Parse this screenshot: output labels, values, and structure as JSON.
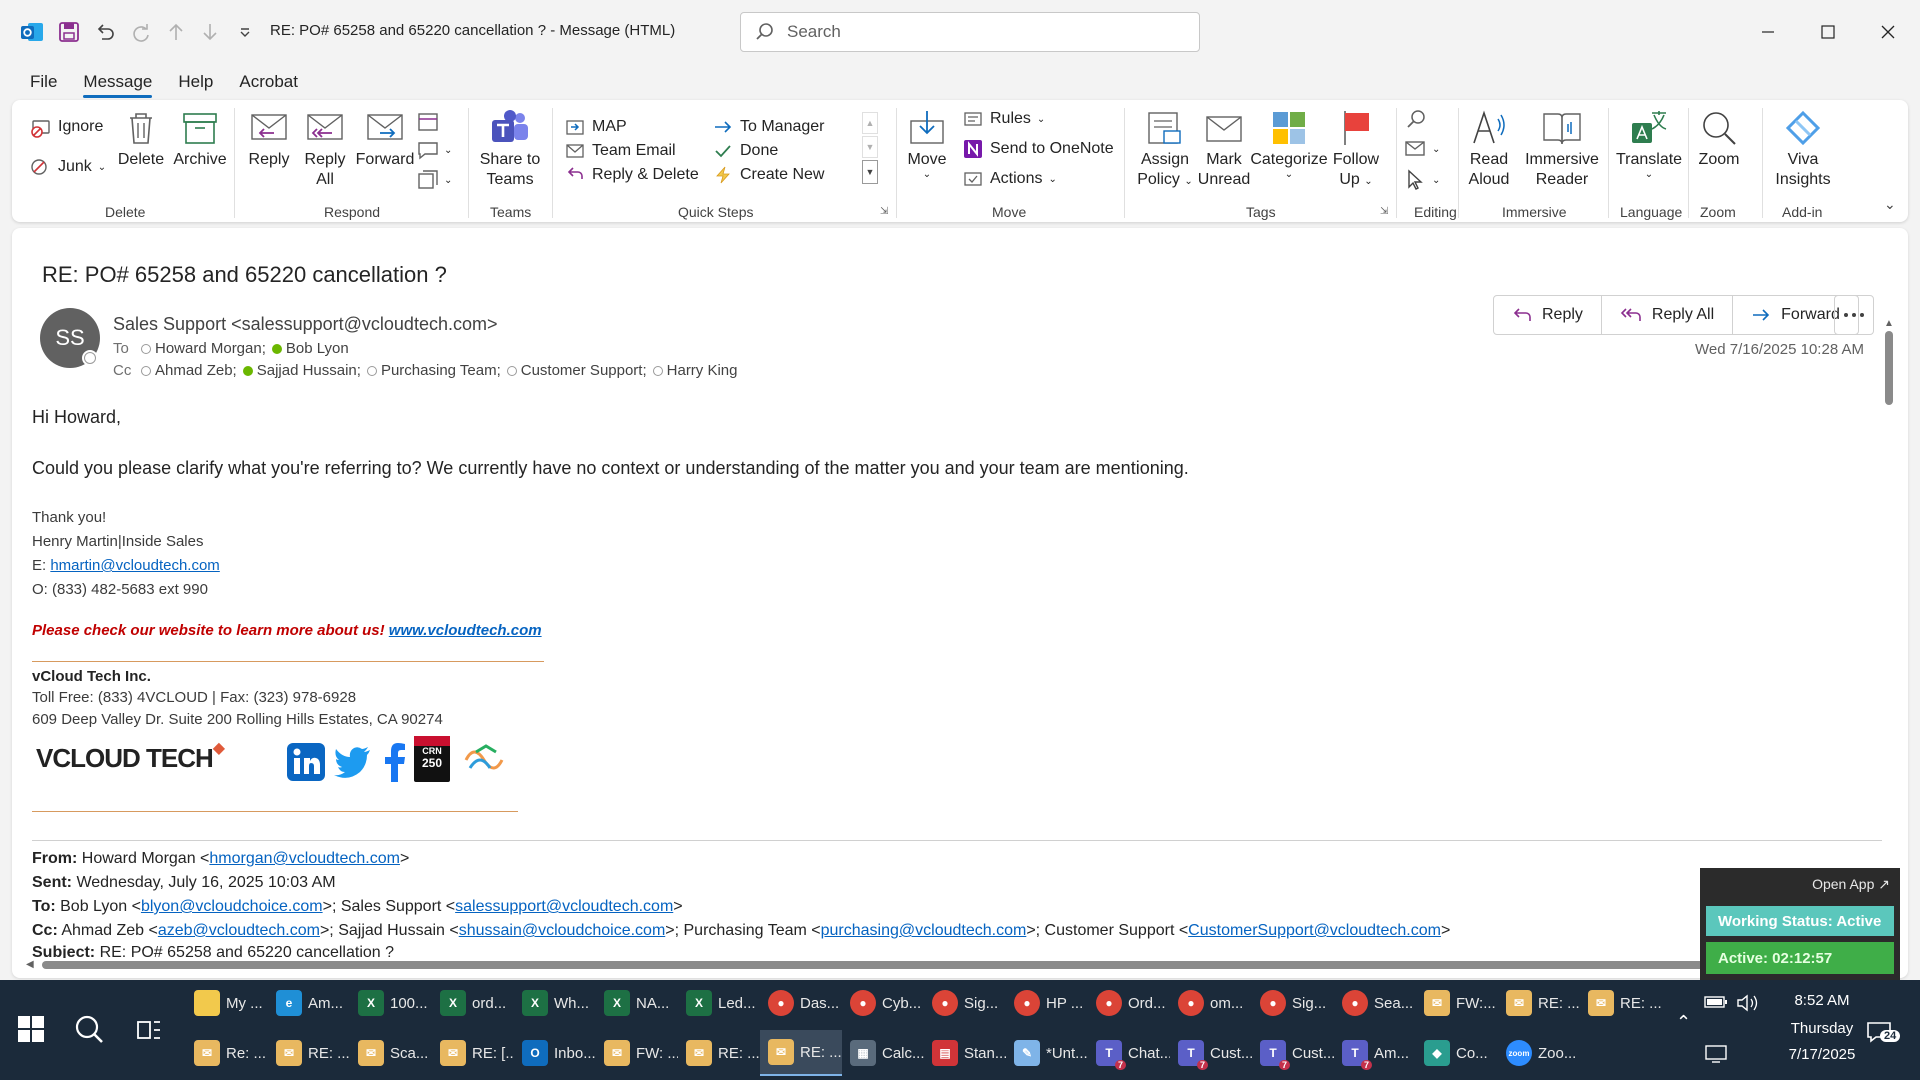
{
  "window": {
    "title": "RE: PO# 65258 and 65220 cancellation ?  -  Message (HTML)",
    "search_placeholder": "Search"
  },
  "menu": {
    "tabs": [
      "File",
      "Message",
      "Help",
      "Acrobat"
    ],
    "active": "Message"
  },
  "ribbon": {
    "delete_group": {
      "label": "Delete",
      "ignore": "Ignore",
      "junk": "Junk",
      "delete": "Delete",
      "archive": "Archive"
    },
    "respond_group": {
      "label": "Respond",
      "reply": "Reply",
      "reply_all_1": "Reply",
      "reply_all_2": "All",
      "forward": "Forward"
    },
    "teams_group": {
      "label": "Teams",
      "share_1": "Share to",
      "share_2": "Teams"
    },
    "quicksteps_group": {
      "label": "Quick Steps",
      "items": [
        "MAP",
        "To Manager",
        "Team Email",
        "Done",
        "Reply & Delete",
        "Create New"
      ]
    },
    "move_group": {
      "label": "Move",
      "move": "Move",
      "rules": "Rules",
      "onenote": "Send to OneNote",
      "actions": "Actions"
    },
    "tags_group": {
      "label": "Tags",
      "assign_1": "Assign",
      "assign_2": "Policy",
      "mark_1": "Mark",
      "mark_2": "Unread",
      "categorize": "Categorize",
      "follow_1": "Follow",
      "follow_2": "Up"
    },
    "editing_group": {
      "label": "Editing"
    },
    "immersive_group": {
      "label": "Immersive",
      "read_1": "Read",
      "read_2": "Aloud",
      "reader_1": "Immersive",
      "reader_2": "Reader"
    },
    "language_group": {
      "label": "Language",
      "translate": "Translate"
    },
    "zoom_group": {
      "label": "Zoom",
      "zoom": "Zoom"
    },
    "addin_group": {
      "label": "Add-in",
      "viva_1": "Viva",
      "viva_2": "Insights"
    }
  },
  "message": {
    "subject": "RE: PO# 65258 and 65220 cancellation ?",
    "avatar_initials": "SS",
    "sender": "Sales Support <salessupport@vcloudtech.com>",
    "to_label": "To",
    "to": [
      "Howard Morgan;",
      "Bob Lyon"
    ],
    "cc_label": "Cc",
    "cc": [
      "Ahmad Zeb;",
      "Sajjad Hussain;",
      "Purchasing Team;",
      "Customer Support;",
      "Harry King"
    ],
    "date": "Wed 7/16/2025 10:28 AM",
    "actions": {
      "reply": "Reply",
      "reply_all": "Reply All",
      "forward": "Forward"
    },
    "greeting": "Hi Howard,",
    "body": "Could you please clarify what you're referring to? We currently have no context or understanding of the matter you and your team are mentioning.",
    "signature": {
      "thanks": "Thank you!",
      "name": "Henry Martin|Inside Sales",
      "email_label": "E: ",
      "email": "hmartin@vcloudtech.com",
      "phone": "O: (833) 482-5683 ext 990",
      "promo": "Please check our website to learn more about us! ",
      "website": "www.vcloudtech.com",
      "company": "vCloud Tech Inc.",
      "tollfree": "Toll Free: (833) 4VCLOUD | Fax: (323) 978-6928",
      "address": "609 Deep Valley Dr. Suite 200 Rolling Hills Estates, CA 90274",
      "logo_text": "VCLOUD TECH"
    },
    "quoted": {
      "from_label": "From:",
      "from_name": " Howard Morgan <",
      "from_email": "hmorgan@vcloudtech.com",
      "from_end": ">",
      "sent_label": "Sent:",
      "sent": " Wednesday, July 16, 2025 10:03 AM",
      "to_label": "To:",
      "to_1": " Bob Lyon <",
      "to_1_email": "blyon@vcloudchoice.com",
      "to_2": ">; Sales Support <",
      "to_2_email": "salessupport@vcloudtech.com",
      "to_end": ">",
      "cc_label": "Cc:",
      "cc_1": " Ahmad Zeb <",
      "cc_1_email": "azeb@vcloudtech.com",
      "cc_2": ">; Sajjad Hussain <",
      "cc_2_email": "shussain@vcloudchoice.com",
      "cc_3": ">; Purchasing Team <",
      "cc_3_email": "purchasing@vcloudtech.com",
      "cc_4": ">; Customer Support <",
      "cc_4_email": "CustomerSupport@vcloudtech.com",
      "cc_end": ">",
      "subject_label": "Subject:",
      "subject": " RE: PO# 65258 and 65220 cancellation ?"
    }
  },
  "widget": {
    "open_app": "Open App ↗",
    "status": "Working Status: Active",
    "active": "Active: 02:12:57"
  },
  "taskbar": {
    "row1": [
      {
        "label": "My ...",
        "icon": "folder-icon",
        "color": "#f2c94c"
      },
      {
        "label": "Am...",
        "icon": "edge-icon",
        "color": "#1f8fd6"
      },
      {
        "label": "100...",
        "icon": "excel-icon",
        "color": "#1d7044"
      },
      {
        "label": "ord...",
        "icon": "excel-icon",
        "color": "#1d7044"
      },
      {
        "label": "Wh...",
        "icon": "excel-icon",
        "color": "#1d7044"
      },
      {
        "label": "NA...",
        "icon": "excel-icon",
        "color": "#1d7044"
      },
      {
        "label": "Led...",
        "icon": "excel-icon",
        "color": "#1d7044"
      },
      {
        "label": "Das...",
        "icon": "chrome-icon",
        "color": "#db4437"
      },
      {
        "label": "Cyb...",
        "icon": "chrome-icon",
        "color": "#db4437"
      },
      {
        "label": "Sig...",
        "icon": "chrome-icon",
        "color": "#db4437"
      },
      {
        "label": "HP ...",
        "icon": "chrome-icon",
        "color": "#db4437"
      },
      {
        "label": "Ord...",
        "icon": "chrome-icon",
        "color": "#db4437"
      },
      {
        "label": "om...",
        "icon": "chrome-icon",
        "color": "#db4437"
      },
      {
        "label": "Sig...",
        "icon": "chrome-icon",
        "color": "#db4437"
      },
      {
        "label": "Sea...",
        "icon": "chrome-icon",
        "color": "#db4437"
      },
      {
        "label": "FW:...",
        "icon": "mail-icon",
        "color": "#e8b860"
      },
      {
        "label": "RE: ...",
        "icon": "mail-icon",
        "color": "#e8b860"
      },
      {
        "label": "RE: ...",
        "icon": "mail-icon",
        "color": "#e8b860"
      }
    ],
    "row2": [
      {
        "label": "Re: ...",
        "icon": "mail-icon",
        "color": "#e8b860"
      },
      {
        "label": "RE: ...",
        "icon": "mail-icon",
        "color": "#e8b860"
      },
      {
        "label": "Sca...",
        "icon": "mail-icon",
        "color": "#e8b860"
      },
      {
        "label": "RE: [...",
        "icon": "mail-icon",
        "color": "#e8b860"
      },
      {
        "label": "Inbo...",
        "icon": "outlook-icon",
        "color": "#0f6cbd"
      },
      {
        "label": "FW: ...",
        "icon": "mail-icon",
        "color": "#e8b860"
      },
      {
        "label": "RE: ...",
        "icon": "mail-icon",
        "color": "#e8b860"
      },
      {
        "label": "RE: ...",
        "icon": "mail-icon",
        "color": "#e8b860"
      },
      {
        "label": "Calc...",
        "icon": "calculator-icon",
        "color": "#5a6b7c"
      },
      {
        "label": "Stan...",
        "icon": "pdf-icon",
        "color": "#d13438"
      },
      {
        "label": "*Unt...",
        "icon": "notepad-icon",
        "color": "#7fb4e8"
      },
      {
        "label": "Chat...",
        "icon": "teams-icon",
        "color": "#5b5fc7"
      },
      {
        "label": "Cust...",
        "icon": "teams-icon",
        "color": "#5b5fc7"
      },
      {
        "label": "Cust...",
        "icon": "teams-icon",
        "color": "#5b5fc7"
      },
      {
        "label": "Am...",
        "icon": "teams-icon",
        "color": "#5b5fc7"
      },
      {
        "label": "Co...",
        "icon": "copilot-icon",
        "color": "#2a9d8f"
      },
      {
        "label": "Zoo...",
        "icon": "zoom-icon",
        "color": "#2d8cff"
      }
    ],
    "badge_teams": "7",
    "time": "8:52 AM",
    "day": "Thursday",
    "date": "7/17/2025",
    "notif_count": "24"
  }
}
